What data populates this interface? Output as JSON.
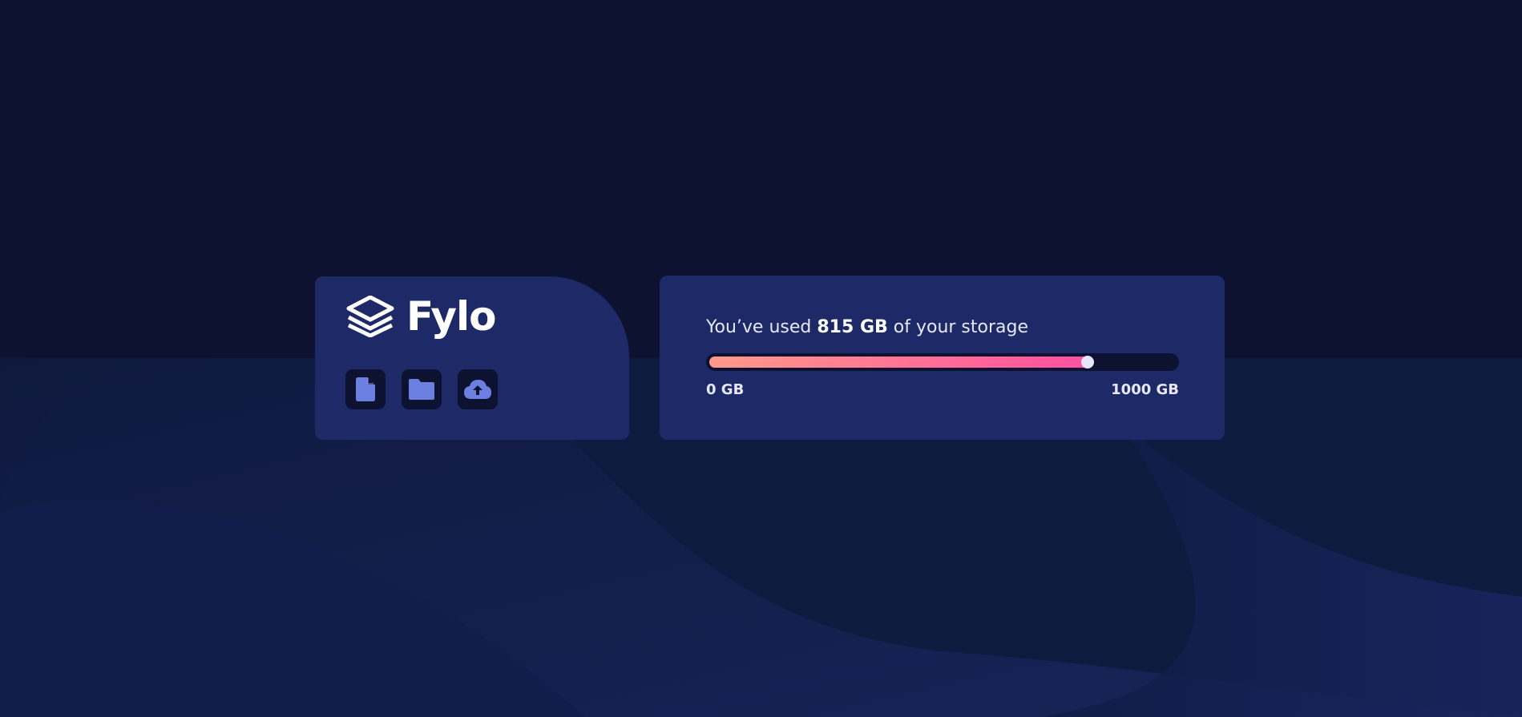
{
  "app": {
    "name": "Fylo"
  },
  "toolbar": {
    "icons": [
      "document-icon",
      "folder-icon",
      "cloud-upload-icon"
    ]
  },
  "storage": {
    "prefix": "You’ve used ",
    "used": "815 GB",
    "suffix": " of your storage",
    "min_label": "0 GB",
    "max_label": "1000 GB",
    "used_fraction": 0.815
  },
  "colors": {
    "background": "#0c1230",
    "card": "#1e2a68",
    "icon_accent": "#6b7fe0",
    "gradient_start": "#ff9a8a",
    "gradient_end": "#ff4fa0",
    "thumb": "#e6e6f8"
  }
}
